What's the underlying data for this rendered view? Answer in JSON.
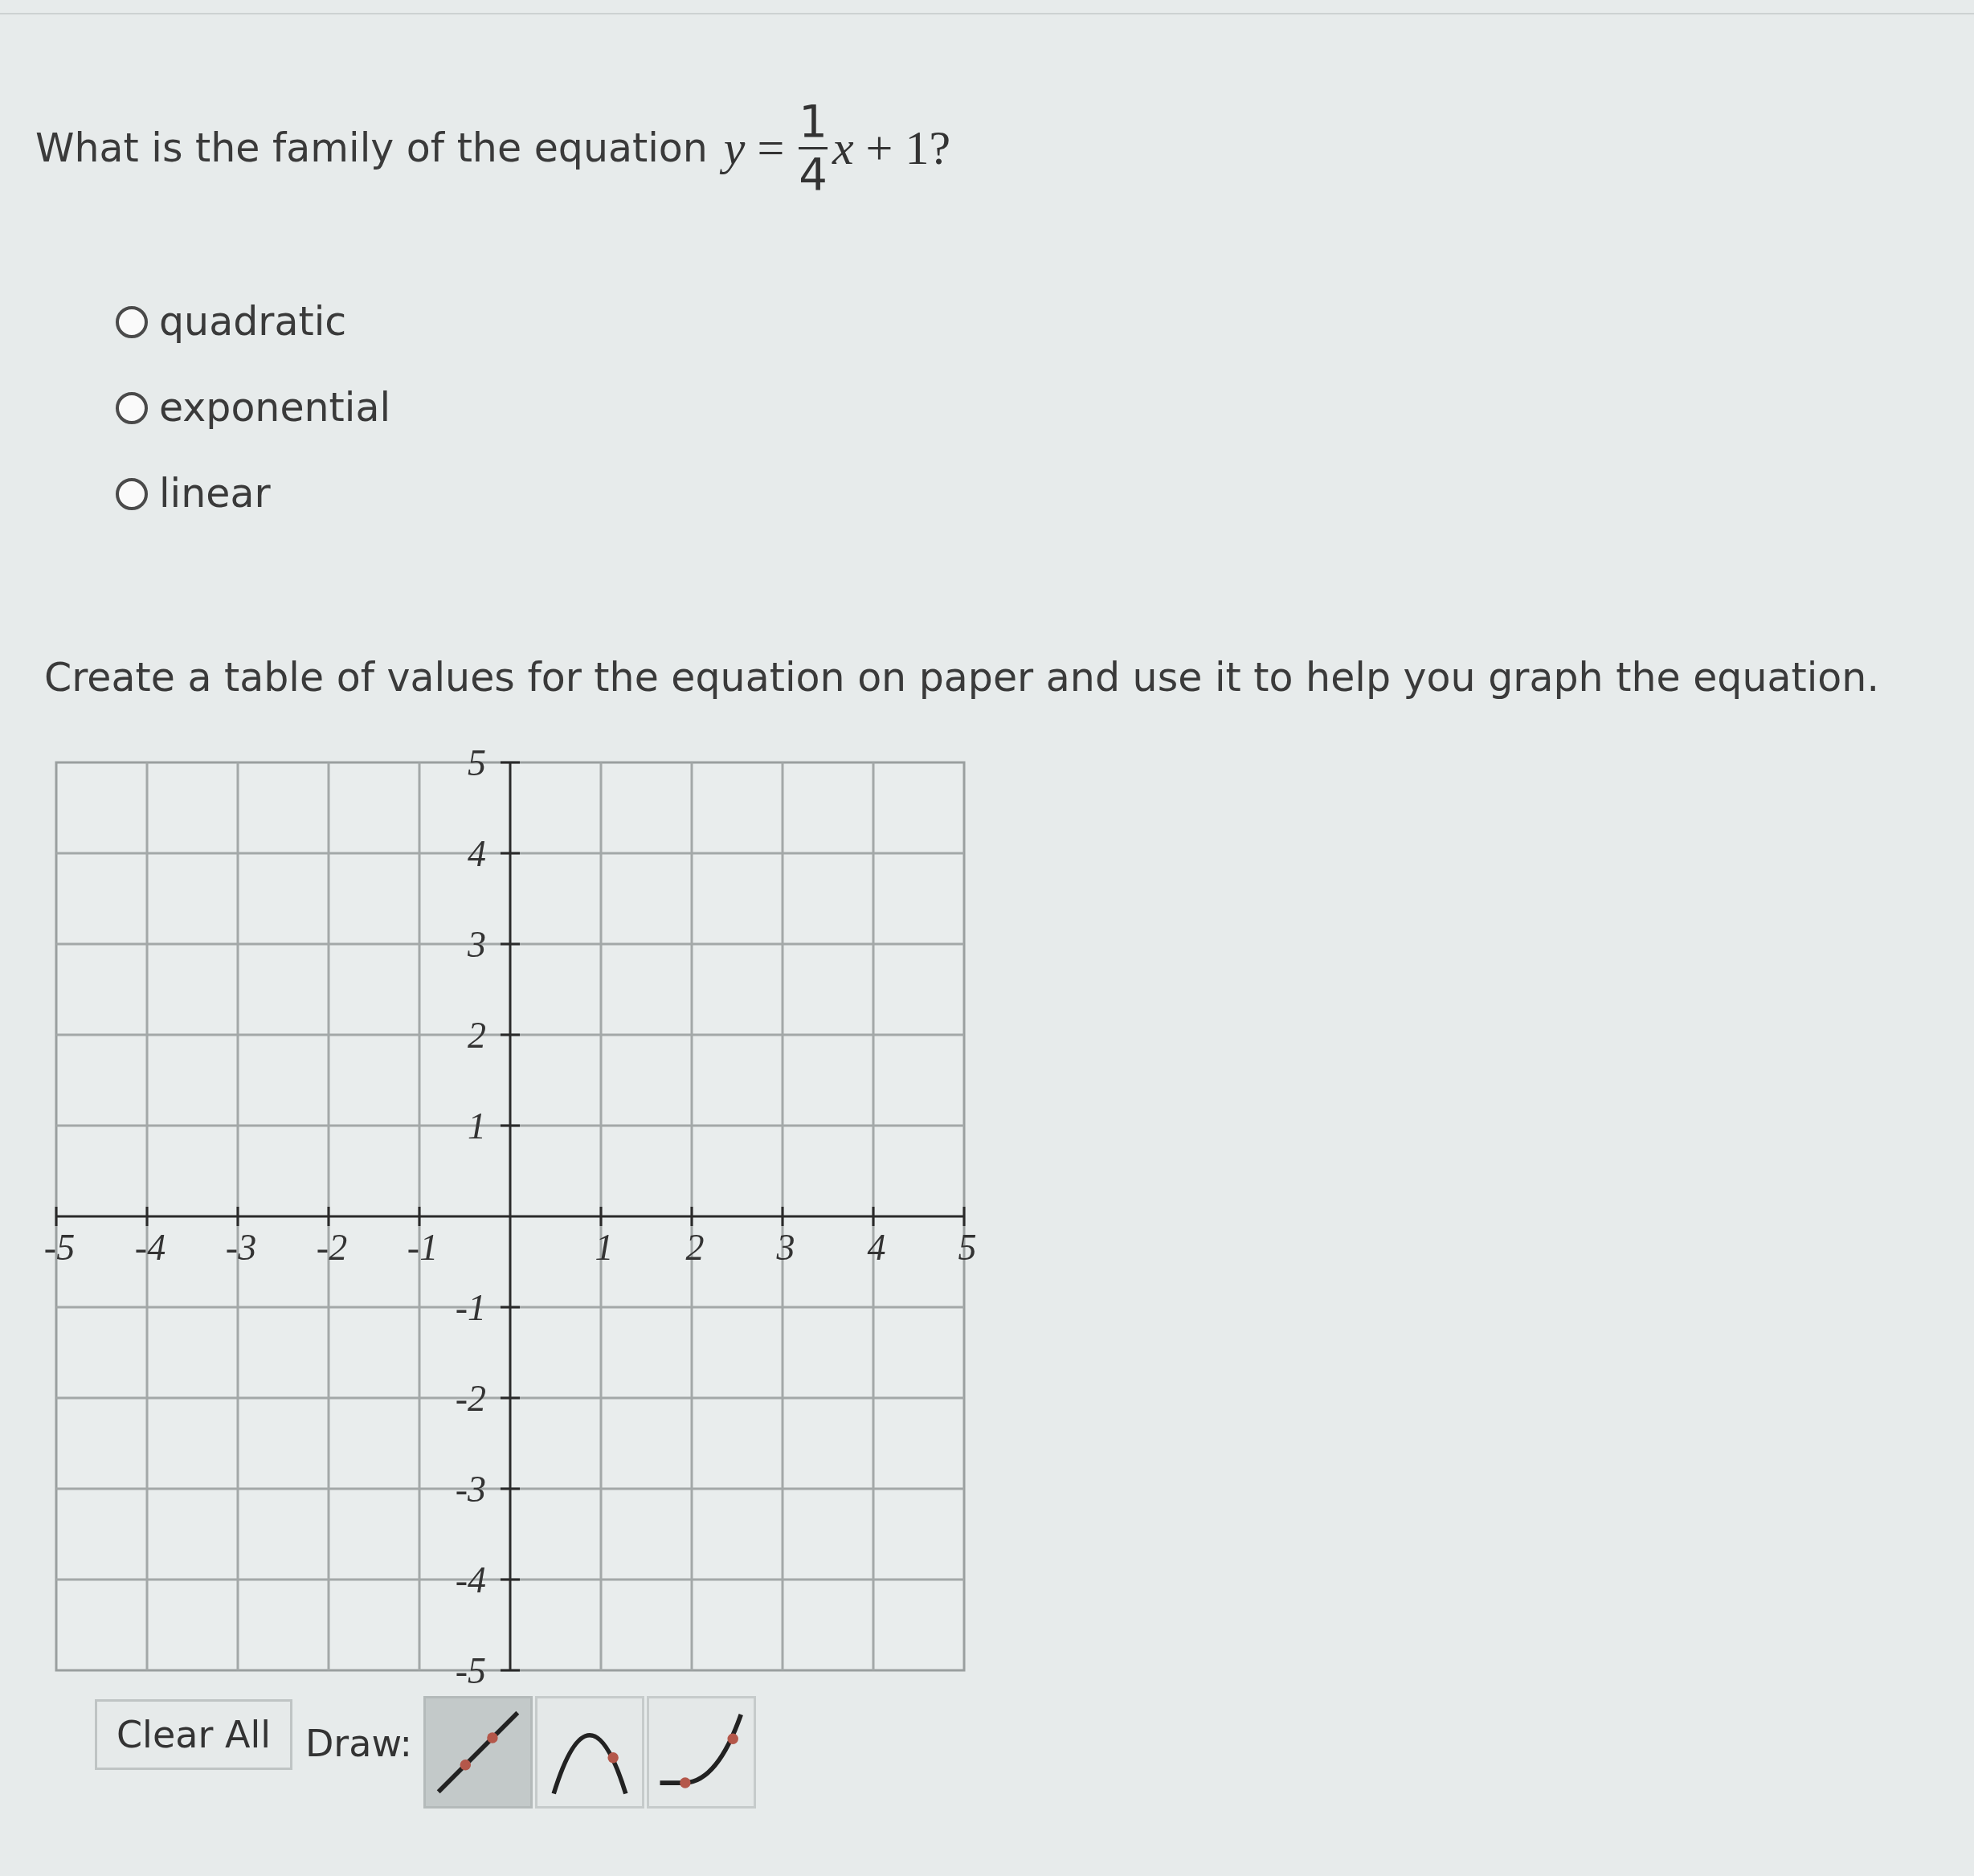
{
  "question": {
    "prompt": "What is the family of the equation",
    "equation": {
      "left": "*y* =",
      "numerator": "1",
      "denominator": "4",
      "right": "*x* + 1?"
    }
  },
  "options": [
    {
      "label": "quadratic",
      "selected": false
    },
    {
      "label": "exponential",
      "selected": false
    },
    {
      "label": "linear",
      "selected": false
    }
  ],
  "instruction": "Create a table of values for the equation on paper and use it to help you graph the equation.",
  "graph": {
    "chart_data": {
      "type": "scatter",
      "xlim": [
        -5,
        5
      ],
      "ylim": [
        -5,
        5
      ],
      "xticks": [
        -5,
        -4,
        -3,
        -2,
        -1,
        1,
        2,
        3,
        4,
        5
      ],
      "yticks": [
        5,
        4,
        3,
        2,
        1,
        -1,
        -2,
        -3,
        -4,
        -5
      ],
      "grid": true
    }
  },
  "toolbar": {
    "clear_button": "Clear All",
    "draw_label": "Draw:",
    "tools": [
      {
        "kind": "line",
        "selected": true
      },
      {
        "kind": "parabola",
        "selected": false
      },
      {
        "kind": "curve",
        "selected": false
      }
    ]
  }
}
